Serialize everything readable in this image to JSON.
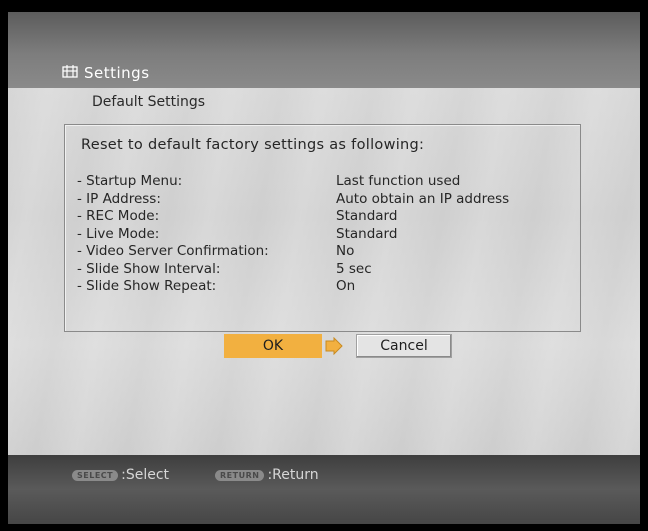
{
  "header": {
    "title": "Settings",
    "icon": "settings-icon"
  },
  "subtitle": "Default Settings",
  "panel": {
    "heading": "Reset to default factory settings as following:",
    "rows": [
      {
        "label": "- Startup Menu:",
        "value": "Last function used"
      },
      {
        "label": "- IP Address:",
        "value": "Auto obtain an IP address"
      },
      {
        "label": "- REC Mode:",
        "value": "Standard"
      },
      {
        "label": "- Live Mode:",
        "value": "Standard"
      },
      {
        "label": "- Video Server Confirmation:",
        "value": "No"
      },
      {
        "label": "- Slide Show Interval:",
        "value": "5 sec"
      },
      {
        "label": "- Slide Show Repeat:",
        "value": "On"
      }
    ]
  },
  "buttons": {
    "ok_label": "OK",
    "cancel_label": "Cancel"
  },
  "footer": {
    "select_key": "SELECT",
    "select_label": ":Select",
    "return_key": "RETURN",
    "return_label": ":Return"
  },
  "colors": {
    "ok_highlight": "#f2b040",
    "cursor_arrow": "#f2b040"
  }
}
